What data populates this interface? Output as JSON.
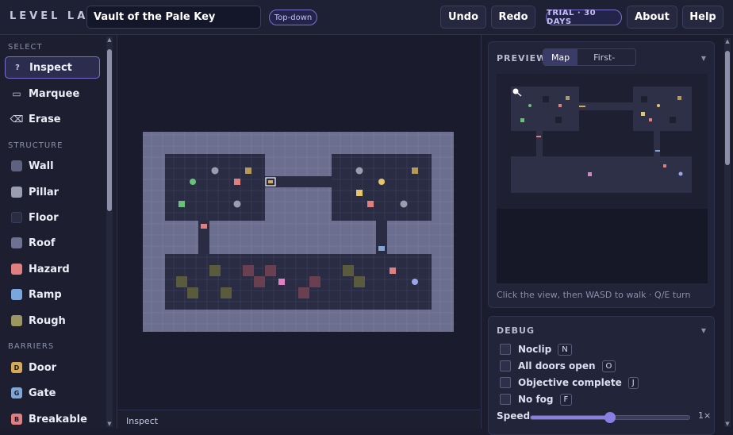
{
  "app": {
    "brand": "LEVEL LAB",
    "title": "Vault of the Pale Key",
    "view_mode": "Top-down",
    "undo_label": "Undo",
    "redo_label": "Redo",
    "trial_badge": "TRIAL · 30 DAYS",
    "about_label": "About",
    "help_label": "Help"
  },
  "sidebar": {
    "sections": [
      {
        "title": "SELECT",
        "items": [
          {
            "label": "Inspect",
            "glyph": "?",
            "icon": "question-icon",
            "active": true
          },
          {
            "label": "Marquee",
            "glyph": "▭",
            "icon": "marquee-icon"
          },
          {
            "label": "Erase",
            "glyph": "⌫",
            "icon": "erase-icon"
          }
        ]
      },
      {
        "title": "STRUCTURE",
        "items": [
          {
            "label": "Wall",
            "color": "#5f6180"
          },
          {
            "label": "Pillar",
            "color": "#9a9cb0"
          },
          {
            "label": "Floor",
            "color": "#2a2c44"
          },
          {
            "label": "Roof",
            "color": "#6e7192"
          },
          {
            "label": "Hazard",
            "color": "#e07f7f"
          },
          {
            "label": "Ramp",
            "color": "#7aa6e0"
          },
          {
            "label": "Rough",
            "color": "#9c9660"
          }
        ]
      },
      {
        "title": "BARRIERS",
        "items": [
          {
            "label": "Door",
            "glyph": "D",
            "color": "#d6a957"
          },
          {
            "label": "Gate",
            "glyph": "G",
            "color": "#7fa6d6"
          },
          {
            "label": "Breakable",
            "glyph": "B",
            "color": "#e07f7f"
          }
        ]
      }
    ]
  },
  "status": {
    "text": "Inspect"
  },
  "preview": {
    "title": "PREVIEW",
    "tabs": [
      "Map",
      "First-"
    ],
    "hint": "Click the view, then WASD to walk · Q/E turn"
  },
  "debug": {
    "title": "DEBUG",
    "options": [
      {
        "label": "Noclip",
        "key": "N"
      },
      {
        "label": "All doors open",
        "key": "O"
      },
      {
        "label": "Objective complete",
        "key": "J"
      },
      {
        "label": "No fog",
        "key": "F"
      }
    ],
    "speed_label": "Speed",
    "speed_value": "1×",
    "speed_fraction": 0.5
  },
  "icons": {
    "chevron": "chevron-down-icon"
  },
  "colors": {
    "accent": "#7c6fd0",
    "wall": "#5f6180",
    "floor": "#2a2c44",
    "hazard": "#e07f7f",
    "rough": "#5a5a3c"
  }
}
